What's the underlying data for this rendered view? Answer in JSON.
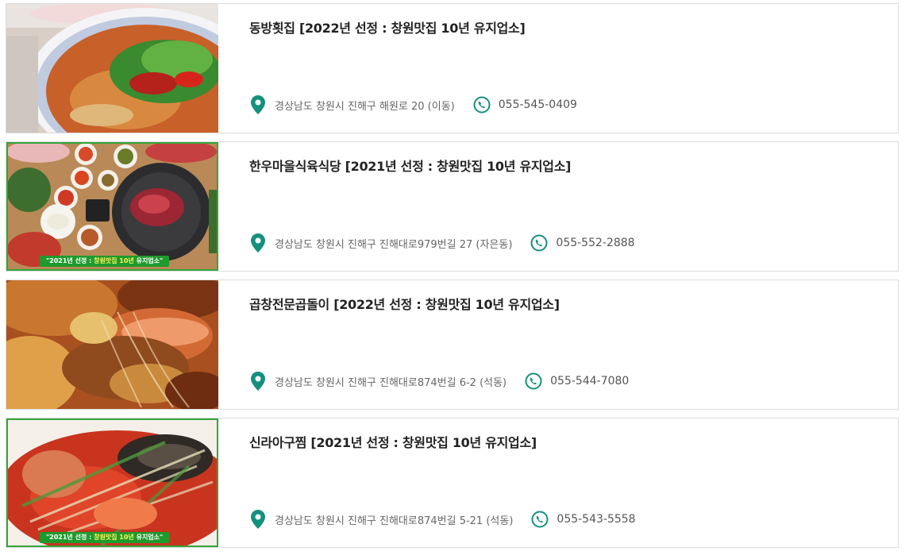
{
  "accent_color": "#16907e",
  "listings": [
    {
      "title": "동방횟집 [2022년 선정 : 창원맛집 10년 유지업소]",
      "image_icon": "seafood-stew-photo",
      "address": "경상남도 창원시 진해구 해원로 20 (이동)",
      "phone": "055-545-0409",
      "banner": ""
    },
    {
      "title": "한우마을식육식당 [2021년 선정 : 창원맛집 10년 유지업소]",
      "image_icon": "korean-bbq-photo",
      "address": "경상남도 창원시 진해구 진해대로979번길 27 (자은동)",
      "phone": "055-552-2888",
      "banner": "\"2021년 선정 : 창원맛집 10년 유지업소\""
    },
    {
      "title": "곱창전문곱돌이 [2022년 선정 : 창원맛집 10년 유지업소]",
      "image_icon": "shrimp-dish-photo",
      "address": "경상남도 창원시 진해구 진해대로874번길 6-2 (석동)",
      "phone": "055-544-7080",
      "banner": ""
    },
    {
      "title": "신라아구찜 [2021년 선정 : 창원맛집 10년 유지업소]",
      "image_icon": "braised-monkfish-photo",
      "address": "경상남도 창원시 진해구 진해대로874번길 5-21 (석동)",
      "phone": "055-543-5558",
      "banner": "\"2021년 선정 : 창원맛집 10년 유지업소\""
    }
  ]
}
